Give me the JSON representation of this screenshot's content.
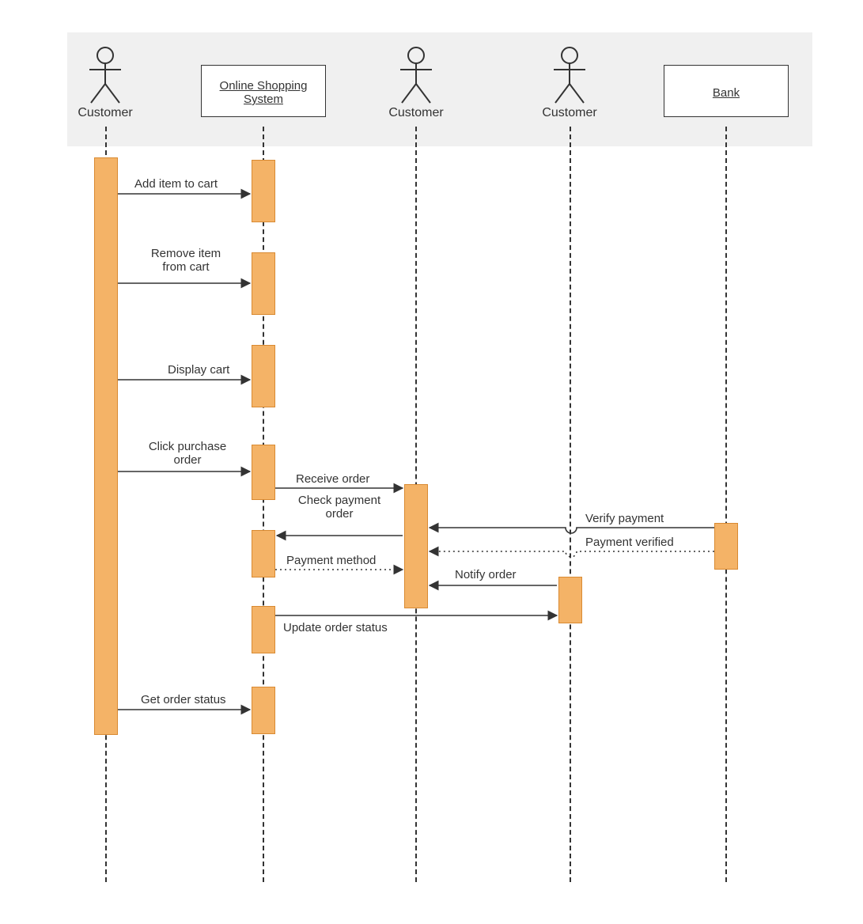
{
  "diagram": {
    "type": "sequence",
    "participants": {
      "customer1": "Customer",
      "system": "Online Shopping System",
      "customer2": "Customer",
      "customer3": "Customer",
      "bank": "Bank"
    },
    "messages": {
      "m1": "Add item to cart",
      "m2": "Remove item from cart",
      "m3": "Display cart",
      "m4": "Click purchase order",
      "m5": "Receive order",
      "m6": "Check payment order",
      "m7": "Verify payment",
      "m8": "Payment verified",
      "m9": "Payment method",
      "m10": "Notify order",
      "m11": "Update order status",
      "m12": "Get order status"
    }
  }
}
